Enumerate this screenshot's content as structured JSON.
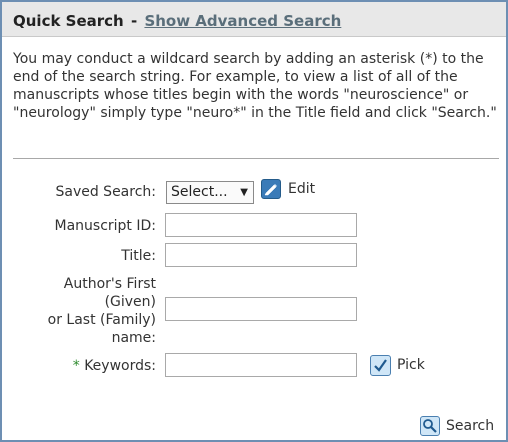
{
  "header": {
    "title": "Quick Search",
    "separator": "-",
    "advanced_link": "Show Advanced Search"
  },
  "intro_text": "You may conduct a wildcard search by adding an asterisk (*) to the end of the search string. For example, to view a list of all of the manuscripts whose titles begin with the words \"neuroscience\" or \"neurology\" simply type \"neuro*\" in the Title field and click \"Search.\"",
  "form": {
    "saved_search": {
      "label": "Saved Search:",
      "selected": "Select...",
      "edit_label": "Edit"
    },
    "manuscript_id": {
      "label": "Manuscript ID:",
      "value": ""
    },
    "title": {
      "label": "Title:",
      "value": ""
    },
    "author": {
      "label_line1": "Author's First",
      "label_line2": "(Given)",
      "label_line3": "or Last (Family)",
      "label_line4": "name:",
      "value": ""
    },
    "keywords": {
      "required_mark": "*",
      "label": "Keywords:",
      "value": "",
      "pick_label": "Pick"
    }
  },
  "search_button_label": "Search",
  "colors": {
    "border": "#6d8fb3",
    "required": "#2e8b2e",
    "icon_blue": "#3a7bb8"
  },
  "icons": [
    "edit-icon",
    "check-icon",
    "search-icon"
  ]
}
